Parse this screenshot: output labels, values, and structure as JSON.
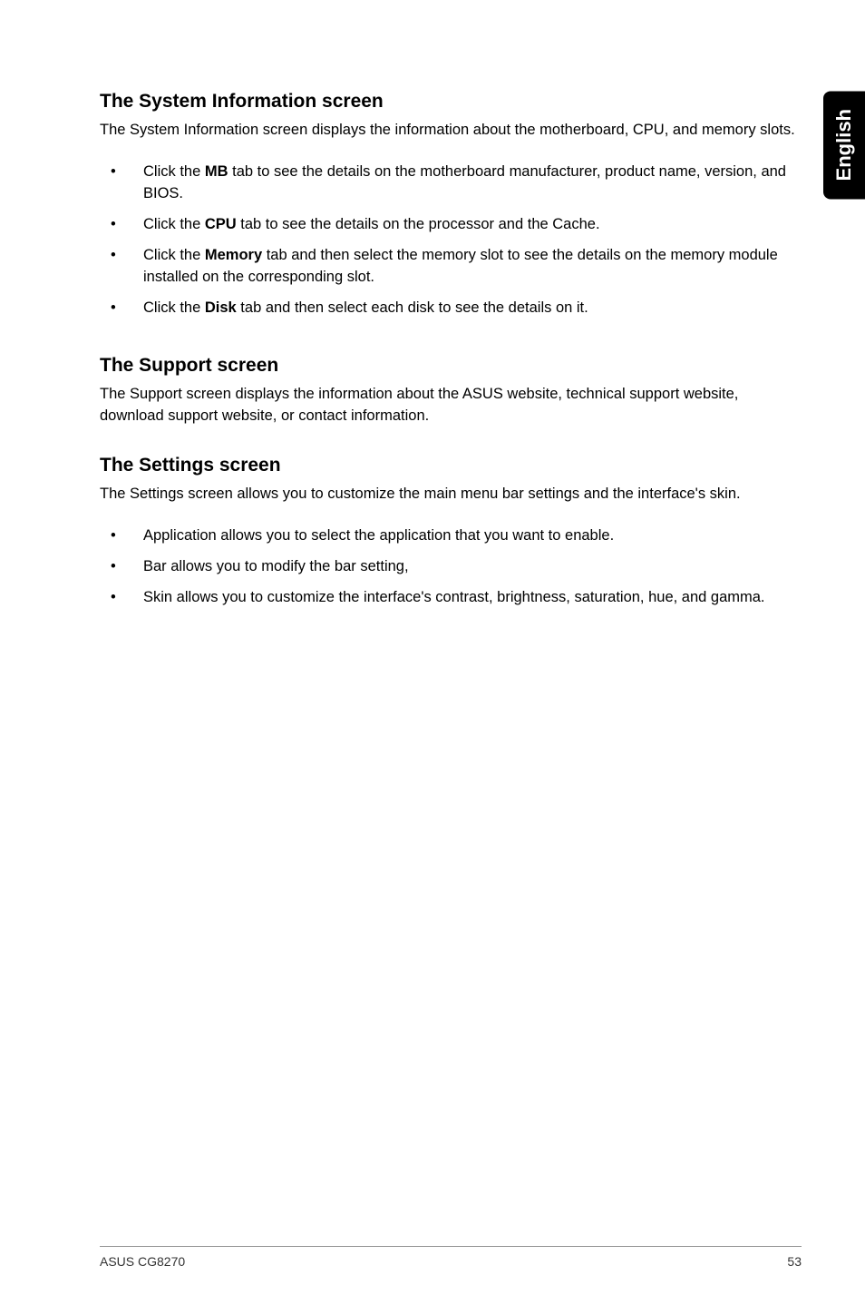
{
  "sideTab": "English",
  "sections": [
    {
      "heading": "The System Information screen",
      "intro": "The System Information screen displays the information about the motherboard, CPU, and memory slots.",
      "items": [
        {
          "pre": "Click the ",
          "bold": "MB",
          "post": " tab to see the details on the motherboard manufacturer, product name, version, and BIOS."
        },
        {
          "pre": "Click the ",
          "bold": "CPU",
          "post": " tab to see the details on the processor and the Cache."
        },
        {
          "pre": "Click the ",
          "bold": "Memory",
          "post": " tab and then select the memory slot to see the details on the memory module installed on the corresponding slot."
        },
        {
          "pre": "Click the ",
          "bold": "Disk",
          "post": " tab and then select each disk to see the details on it."
        }
      ]
    },
    {
      "heading": "The Support screen",
      "intro": "The Support screen displays the information about the ASUS website, technical support website, download support website, or contact information.",
      "items": []
    },
    {
      "heading": "The Settings screen",
      "intro": "The Settings screen allows you to customize the main menu bar settings and the interface's skin.",
      "items": [
        {
          "pre": "Application allows you to select the application that you want to enable.",
          "bold": "",
          "post": ""
        },
        {
          "pre": "Bar allows you to modify the bar setting,",
          "bold": "",
          "post": ""
        },
        {
          "pre": "Skin allows you to customize the interface's contrast, brightness, saturation, hue, and gamma.",
          "bold": "",
          "post": ""
        }
      ]
    }
  ],
  "footer": {
    "left": "ASUS CG8270",
    "right": "53"
  }
}
